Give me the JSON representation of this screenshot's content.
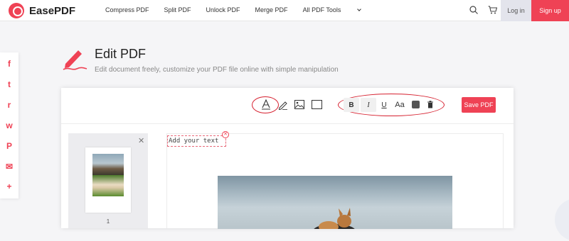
{
  "header": {
    "brand": "EasePDF",
    "nav": [
      "Compress PDF",
      "Split PDF",
      "Unlock PDF",
      "Merge PDF",
      "All PDF Tools"
    ],
    "login": "Log in",
    "signup": "Sign up",
    "icons": [
      "search-icon",
      "cart-icon",
      "chevron-down-icon"
    ]
  },
  "share": {
    "items": [
      {
        "name": "facebook-icon",
        "glyph": "f"
      },
      {
        "name": "twitter-icon",
        "glyph": "t"
      },
      {
        "name": "reddit-icon",
        "glyph": "r"
      },
      {
        "name": "whatsapp-icon",
        "glyph": "w"
      },
      {
        "name": "pinterest-icon",
        "glyph": "P"
      },
      {
        "name": "email-icon",
        "glyph": "✉"
      },
      {
        "name": "more-icon",
        "glyph": "+"
      }
    ],
    "color": "#ef4255"
  },
  "page": {
    "title": "Edit PDF",
    "subtitle": "Edit document freely, customize your PDF file online with simple manipulation"
  },
  "toolbar": {
    "tools": [
      "text-tool-icon",
      "pen-tool-icon",
      "image-tool-icon",
      "rectangle-tool-icon"
    ],
    "format": {
      "bold": "B",
      "italic": "I",
      "underline": "U",
      "font_size": "Aa",
      "color": "#555555"
    },
    "save": "Save PDF"
  },
  "thumbnails": {
    "pages": [
      {
        "number": "1"
      }
    ]
  },
  "canvas": {
    "text_box": "Add your text"
  },
  "colors": {
    "accent": "#ef4255",
    "highlight": "#d6202f"
  }
}
